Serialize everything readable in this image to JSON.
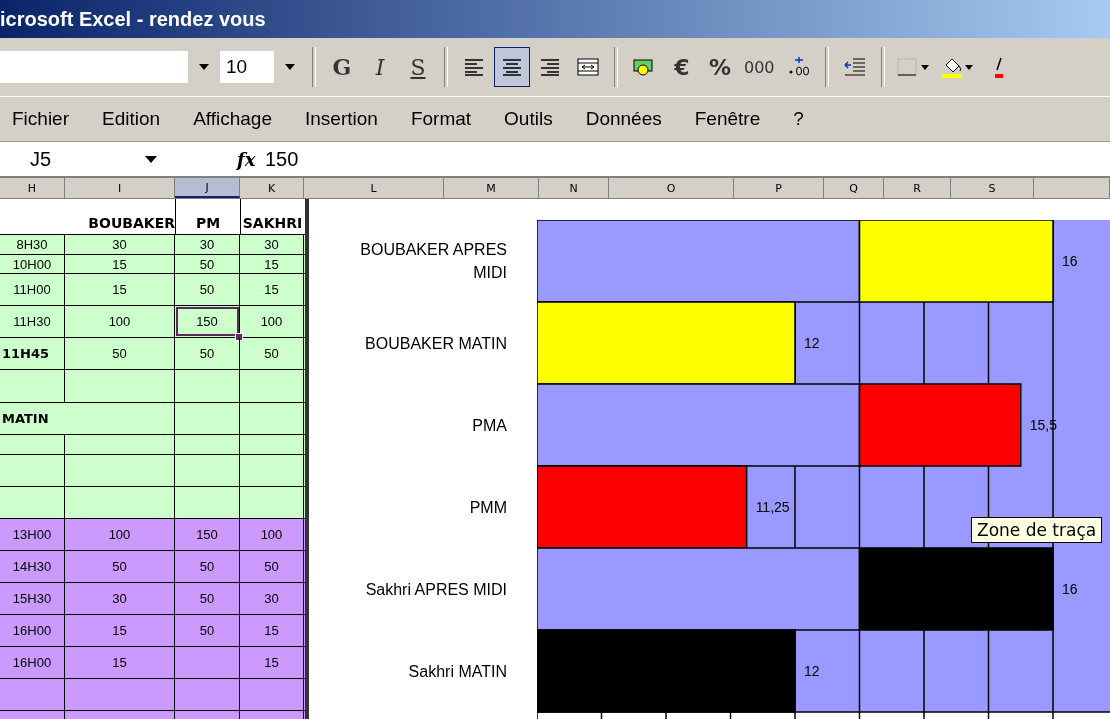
{
  "window": {
    "title": "icrosoft Excel - rendez vous"
  },
  "toolbar": {
    "font_size": "10",
    "groups": [
      [
        {
          "kind": "bold-letter",
          "label": "G",
          "selected": false
        },
        {
          "kind": "italic-letter",
          "label": "I",
          "selected": false
        },
        {
          "kind": "underline-letter",
          "label": "S",
          "selected": false
        }
      ],
      [
        {
          "kind": "align-left",
          "selected": false
        },
        {
          "kind": "align-center",
          "selected": true
        },
        {
          "kind": "align-right",
          "selected": false
        },
        {
          "kind": "merge-cells",
          "selected": false
        }
      ],
      [
        {
          "kind": "money",
          "selected": false
        },
        {
          "kind": "symbol",
          "label": "€",
          "selected": false
        },
        {
          "kind": "symbol",
          "label": "%",
          "selected": false
        },
        {
          "kind": "small-symbol",
          "label": "000",
          "selected": false
        },
        {
          "kind": "decimals",
          "selected": false
        }
      ],
      [
        {
          "kind": "indent",
          "selected": false
        }
      ],
      [
        {
          "kind": "borders",
          "selected": false
        },
        {
          "kind": "fill-color",
          "selected": false
        },
        {
          "kind": "font-color",
          "selected": false
        }
      ]
    ]
  },
  "menu": [
    "Fichier",
    "Edition",
    "Affichage",
    "Insertion",
    "Format",
    "Outils",
    "Données",
    "Fenêtre",
    "?"
  ],
  "formula_bar": {
    "cell": "J5",
    "function_label": "fx",
    "value": "150"
  },
  "columns": [
    {
      "label": "H",
      "selected": false
    },
    {
      "label": "I",
      "selected": false
    },
    {
      "label": "J",
      "selected": true
    },
    {
      "label": "K",
      "selected": false
    },
    {
      "label": "L",
      "selected": false
    },
    {
      "label": "M",
      "selected": false
    },
    {
      "label": "N",
      "selected": false
    },
    {
      "label": "O",
      "selected": false
    },
    {
      "label": "P",
      "selected": false
    },
    {
      "label": "Q",
      "selected": false
    },
    {
      "label": "R",
      "selected": false
    },
    {
      "label": "S",
      "selected": false
    }
  ],
  "sheet": {
    "header": [
      "BOUBAKER",
      "PM",
      "SAKHRI"
    ],
    "rows": [
      {
        "kind": "normal",
        "color": "#ccffcc",
        "cells": [
          {
            "text": "8H30",
            "selected": false
          },
          {
            "text": "30",
            "selected": false
          },
          {
            "text": "30",
            "selected": false
          },
          {
            "text": "30",
            "selected": false
          }
        ]
      },
      {
        "kind": "normal",
        "color": "#ccffcc",
        "cells": [
          {
            "text": "10H00",
            "selected": false
          },
          {
            "text": "15",
            "selected": false
          },
          {
            "text": "50",
            "selected": false
          },
          {
            "text": "15",
            "selected": false
          }
        ]
      },
      {
        "kind": "normal",
        "color": "#ccffcc",
        "cells": [
          {
            "text": "11H00",
            "selected": false
          },
          {
            "text": "15",
            "selected": false
          },
          {
            "text": "50",
            "selected": false
          },
          {
            "text": "15",
            "selected": false
          }
        ]
      },
      {
        "kind": "normal",
        "color": "#ccffcc",
        "cells": [
          {
            "text": "11H30",
            "selected": false
          },
          {
            "text": "100",
            "selected": false
          },
          {
            "text": "150",
            "selected": true
          },
          {
            "text": "100",
            "selected": false
          }
        ]
      },
      {
        "kind": "bold-label",
        "color": "#ccffcc",
        "cells": [
          {
            "text": "11H45",
            "selected": false
          },
          {
            "text": "50",
            "selected": false
          },
          {
            "text": "50",
            "selected": false
          },
          {
            "text": "50",
            "selected": false
          }
        ]
      },
      {
        "kind": "normal",
        "color": "#ccffcc",
        "cells": [
          {
            "selected": false
          },
          {
            "selected": false
          },
          {
            "selected": false
          },
          {
            "selected": false
          }
        ]
      },
      {
        "kind": "section",
        "color": "#ccffcc",
        "cells": [
          {
            "text": "MATIN",
            "selected": false
          },
          {
            "selected": false
          },
          {
            "selected": false
          }
        ]
      },
      {
        "kind": "normal",
        "color": "#ccffcc",
        "cells": [
          {
            "selected": false
          },
          {
            "selected": false
          },
          {
            "selected": false
          },
          {
            "selected": false
          }
        ]
      },
      {
        "kind": "normal",
        "color": "#ccffcc",
        "cells": [
          {
            "selected": false
          },
          {
            "selected": false
          },
          {
            "selected": false
          },
          {
            "selected": false
          }
        ]
      },
      {
        "kind": "normal",
        "color": "#ccffcc",
        "cells": [
          {
            "selected": false
          },
          {
            "selected": false
          },
          {
            "selected": false
          },
          {
            "selected": false
          }
        ]
      },
      {
        "kind": "normal",
        "color": "#cc99ff",
        "cells": [
          {
            "text": "13H00",
            "selected": false
          },
          {
            "text": "100",
            "selected": false
          },
          {
            "text": "150",
            "selected": false
          },
          {
            "text": "100",
            "selected": false
          }
        ]
      },
      {
        "kind": "normal",
        "color": "#cc99ff",
        "cells": [
          {
            "text": "14H30",
            "selected": false
          },
          {
            "text": "50",
            "selected": false
          },
          {
            "text": "50",
            "selected": false
          },
          {
            "text": "50",
            "selected": false
          }
        ]
      },
      {
        "kind": "normal",
        "color": "#cc99ff",
        "cells": [
          {
            "text": "15H30",
            "selected": false
          },
          {
            "text": "30",
            "selected": false
          },
          {
            "text": "50",
            "selected": false
          },
          {
            "text": "30",
            "selected": false
          }
        ]
      },
      {
        "kind": "normal",
        "color": "#cc99ff",
        "cells": [
          {
            "text": "16H00",
            "selected": false
          },
          {
            "text": "15",
            "selected": false
          },
          {
            "text": "50",
            "selected": false
          },
          {
            "text": "15",
            "selected": false
          }
        ]
      },
      {
        "kind": "normal",
        "color": "#cc99ff",
        "cells": [
          {
            "text": "16H00",
            "selected": false
          },
          {
            "text": "15",
            "selected": false
          },
          {
            "selected": false
          },
          {
            "text": "15",
            "selected": false
          }
        ]
      },
      {
        "kind": "normal",
        "color": "#cc99ff",
        "cells": [
          {
            "selected": false
          },
          {
            "selected": false
          },
          {
            "selected": false
          },
          {
            "selected": false
          }
        ]
      },
      {
        "kind": "normal",
        "color": "#cc99ff",
        "cells": [
          {
            "selected": false
          },
          {
            "selected": false
          },
          {
            "selected": false
          },
          {
            "selected": false
          }
        ]
      }
    ]
  },
  "chart": {
    "tooltip": "Zone de traça",
    "rows": [
      {
        "label": "BOUBAKER APRES MIDI",
        "kind": "afternoon",
        "color": "#ffff00",
        "end_label": "16"
      },
      {
        "label": "BOUBAKER MATIN",
        "kind": "morning",
        "color": "#ffff00",
        "end_label": "12"
      },
      {
        "label": "PMA",
        "kind": "afternoon",
        "color": "#ff0000",
        "end_label": "15,5"
      },
      {
        "label": "PMM",
        "kind": "morning",
        "color": "#ff0000",
        "end_label": "11,25"
      },
      {
        "label": "Sakhri  APRES MIDI",
        "kind": "afternoon",
        "color": "#000000",
        "end_label": "16"
      },
      {
        "label": "Sakhri  MATIN",
        "kind": "morning",
        "color": "#000000",
        "end_label": "12"
      }
    ]
  }
}
